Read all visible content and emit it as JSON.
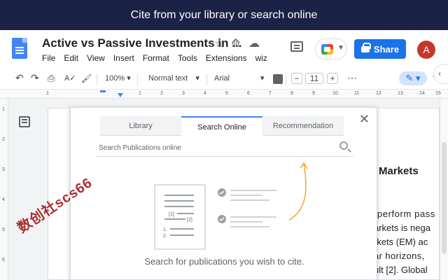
{
  "banner": {
    "text": "Cite from your library or search online"
  },
  "document": {
    "title": "Active vs Passive Investments in ...",
    "menu": [
      "File",
      "Edit",
      "View",
      "Insert",
      "Format",
      "Tools",
      "Extensions",
      "wiz"
    ]
  },
  "header": {
    "share_label": "Share",
    "avatar_initial": "A"
  },
  "toolbar": {
    "zoom": "100%",
    "style": "Normal text",
    "font": "Arial",
    "font_size": "11",
    "minus": "−",
    "plus": "+",
    "more": "⋯"
  },
  "ruler": {
    "h_ticks": [
      "1",
      "1",
      "2",
      "3",
      "4",
      "5",
      "6",
      "7",
      "8",
      "9",
      "10",
      "11",
      "12",
      "13",
      "14",
      "15"
    ],
    "v_ticks": [
      "1",
      "2",
      "3",
      "4",
      "5",
      "6"
    ]
  },
  "doc_body": {
    "heading_fragment": "Markets",
    "lines": [
      "rperform pass",
      "arkets is nega",
      "rkets (EM) ac",
      "ar horizons,",
      "ult [2]. Global"
    ]
  },
  "cite_dialog": {
    "tabs": [
      {
        "label": "Library",
        "active": false
      },
      {
        "label": "Search Online",
        "active": true
      },
      {
        "label": "Recommendation",
        "active": false
      }
    ],
    "search_placeholder": "Search Publications online",
    "illustration_labels": [
      "[1]",
      "[2]",
      "1.",
      "2."
    ],
    "empty_message": "Search for publications you wish to cite."
  },
  "watermark": "数创社scs66",
  "colors": {
    "banner": "#1a2246",
    "share": "#1a73e8",
    "accent_arrow": "#f4a93b",
    "active_tab": "#4285f4",
    "avatar": "#c5372c"
  }
}
